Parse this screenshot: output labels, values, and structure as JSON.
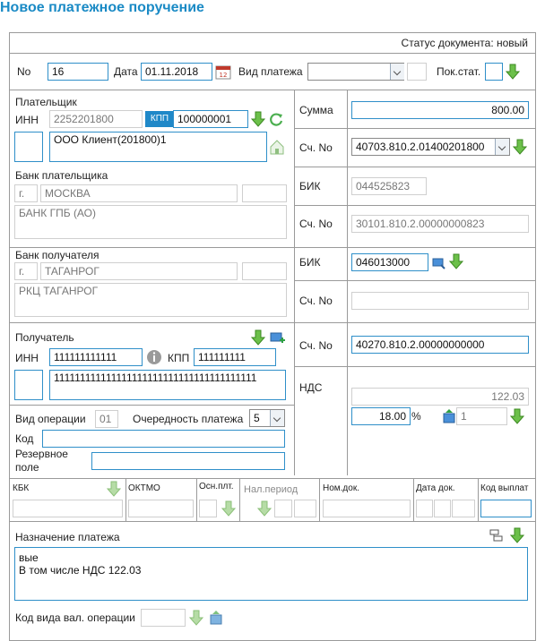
{
  "title": "Новое платежное поручение",
  "status": "Статус документа: новый",
  "header": {
    "no_label": "No",
    "no_value": "16",
    "date_label": "Дата",
    "date_value": "01.11.2018",
    "payment_type_label": "Вид платежа",
    "payment_type_value": "",
    "pok_stat_label": "Пок.стат.",
    "pok_stat_value": ""
  },
  "payer": {
    "section_label": "Плательщик",
    "inn_label": "ИНН",
    "inn_value": "2252201800",
    "kpp_label": "КПП",
    "kpp_value": "100000001",
    "name_value": "ООО Клиент(201800)1",
    "bank_label": "Банк плательщика",
    "city_prefix": "г.",
    "city_value": "МОСКВА",
    "bank_name": "БАНК ГПБ (АО)"
  },
  "right_top": {
    "sum_label": "Сумма",
    "sum_value": "800.00",
    "account_label": "Сч. No",
    "account_value": "40703.810.2.01400201800",
    "bik_label": "БИК",
    "bik_value": "044525823",
    "corr_label": "Сч. No",
    "corr_value": "30101.810.2.00000000823"
  },
  "recipient_bank": {
    "section_label": "Банк получателя",
    "city_prefix": "г.",
    "city_value": "ТАГАНРОГ",
    "bank_name": "РКЦ ТАГАНРОГ",
    "bik_label": "БИК",
    "bik_value": "046013000",
    "corr_label": "Сч. No",
    "corr_value": ""
  },
  "recipient": {
    "section_label": "Получатель",
    "inn_label": "ИНН",
    "inn_value": "111111111111",
    "kpp_label": "КПП",
    "kpp_value": "111111111",
    "name_value": "111111111111111111111111111111111111111",
    "account_label": "Сч. No",
    "account_value": "40270.810.2.00000000000"
  },
  "operation": {
    "type_label": "Вид операции",
    "type_value": "01",
    "priority_label": "Очередность платежа",
    "priority_value": "5",
    "code_label": "Код",
    "code_value": "",
    "reserve_label_1": "Резервное",
    "reserve_label_2": "поле",
    "reserve_value": ""
  },
  "vat": {
    "label": "НДС",
    "amount": "122.03",
    "rate": "18.00",
    "percent_sign": "%",
    "multiplier": "1"
  },
  "tax_row": {
    "kbk": "КБК",
    "oktmo": "ОКТМО",
    "osn": "Осн.плт.",
    "period": "Нал.период",
    "doc_no": "Ном.док.",
    "doc_date": "Дата док.",
    "pay_code": "Код выплат"
  },
  "purpose": {
    "label": "Назначение платежа",
    "line1": "вые",
    "line2": "В том числе НДС 122.03"
  },
  "currency_op": {
    "label": "Код вида вал. операции",
    "value": ""
  }
}
